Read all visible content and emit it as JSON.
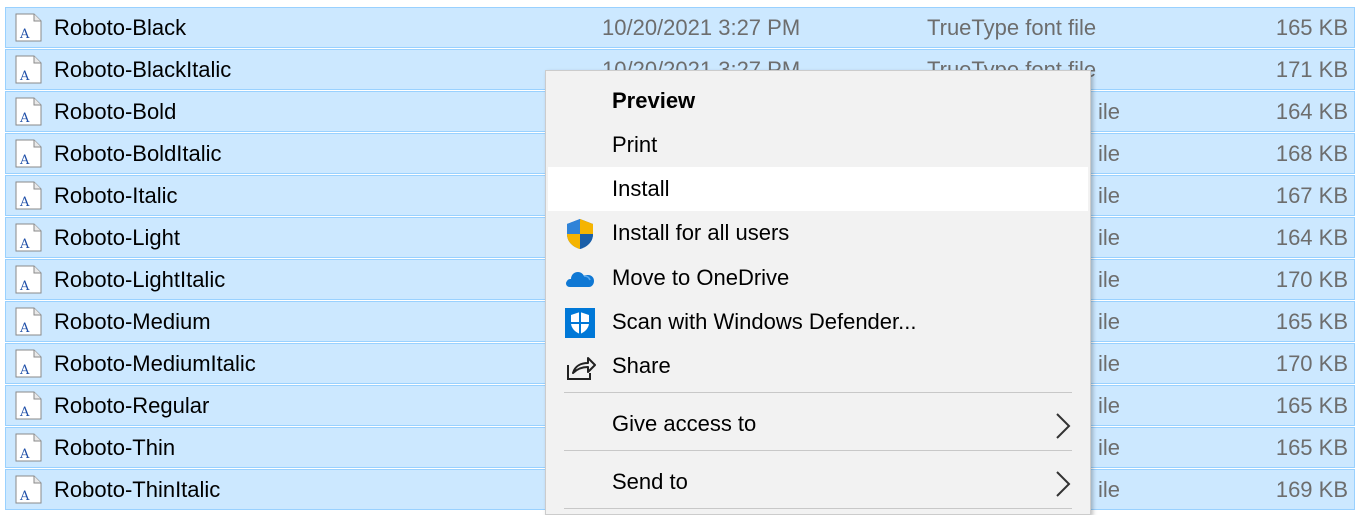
{
  "files": [
    {
      "name": "Roboto-Black",
      "date": "10/20/2021 3:27 PM",
      "type": "TrueType font file",
      "size": "165 KB"
    },
    {
      "name": "Roboto-BlackItalic",
      "date": "10/20/2021 3:27 PM",
      "type": "TrueType font file",
      "size": "171 KB"
    },
    {
      "name": "Roboto-Bold",
      "date": "",
      "type": "",
      "size": "164 KB"
    },
    {
      "name": "Roboto-BoldItalic",
      "date": "",
      "type": "",
      "size": "168 KB"
    },
    {
      "name": "Roboto-Italic",
      "date": "",
      "type": "",
      "size": "167 KB"
    },
    {
      "name": "Roboto-Light",
      "date": "",
      "type": "",
      "size": "164 KB"
    },
    {
      "name": "Roboto-LightItalic",
      "date": "",
      "type": "",
      "size": "170 KB"
    },
    {
      "name": "Roboto-Medium",
      "date": "",
      "type": "",
      "size": "165 KB"
    },
    {
      "name": "Roboto-MediumItalic",
      "date": "",
      "type": "",
      "size": "170 KB"
    },
    {
      "name": "Roboto-Regular",
      "date": "",
      "type": "",
      "size": "165 KB"
    },
    {
      "name": "Roboto-Thin",
      "date": "",
      "type": "",
      "size": "165 KB"
    },
    {
      "name": "Roboto-ThinItalic",
      "date": "",
      "type": "",
      "size": "169 KB"
    }
  ],
  "partial_type_text": "ile",
  "context_menu": {
    "preview": "Preview",
    "print": "Print",
    "install": "Install",
    "install_all_users": "Install for all users",
    "move_onedrive": "Move to OneDrive",
    "scan_defender": "Scan with Windows Defender...",
    "share": "Share",
    "give_access": "Give access to",
    "send_to": "Send to"
  },
  "colors": {
    "selection_bg": "#cce8ff",
    "selection_border": "#99d1ff",
    "menu_bg": "#f2f2f2",
    "menu_hover": "#ffffff",
    "onedrive": "#0f78d4",
    "defender": "#0078d7"
  },
  "icons": {
    "file": "font-file-icon",
    "uac": "uac-shield-icon",
    "onedrive": "onedrive-cloud-icon",
    "defender": "defender-shield-icon",
    "share": "share-icon",
    "submenu": "chevron-right-icon"
  }
}
